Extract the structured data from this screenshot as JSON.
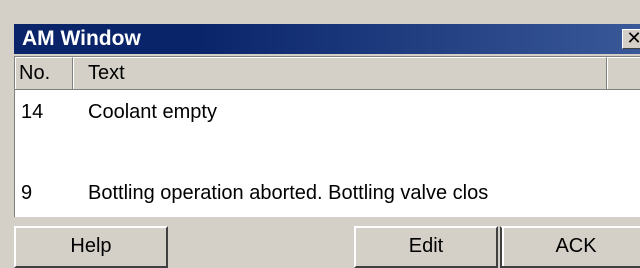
{
  "window": {
    "title": "AM Window",
    "close_glyph": "✕"
  },
  "table": {
    "columns": [
      "No.",
      "Text"
    ],
    "rows": [
      {
        "no": "14",
        "text": "Coolant empty"
      },
      {
        "no": "9",
        "text": "Bottling operation aborted. Bottling valve clos"
      }
    ]
  },
  "buttons": {
    "help": "Help",
    "edit": "Edit",
    "ack": "ACK"
  }
}
